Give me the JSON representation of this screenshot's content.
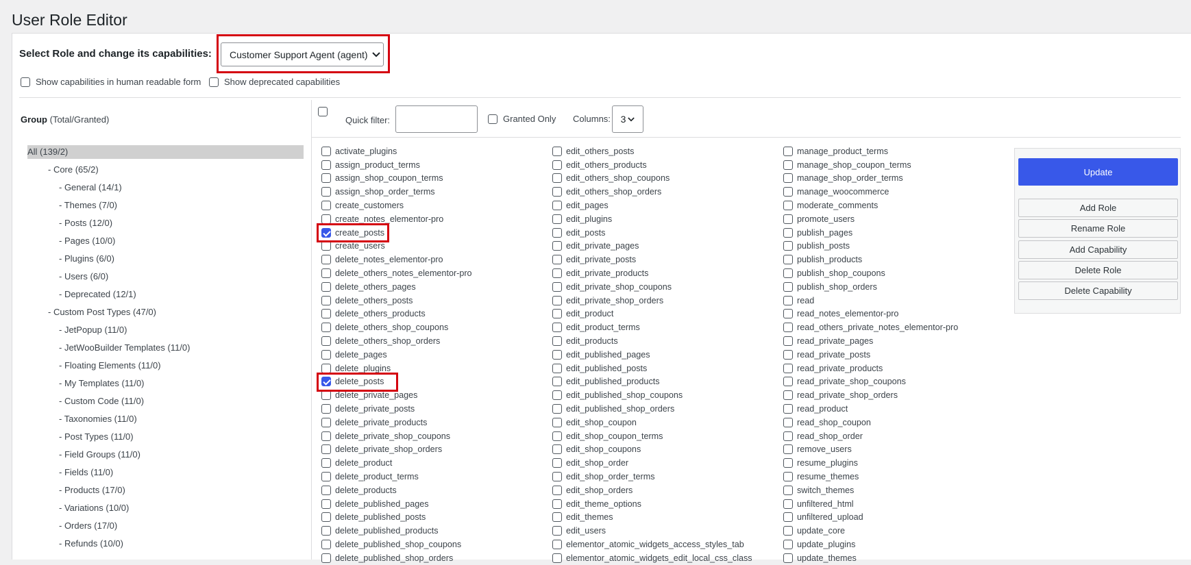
{
  "page_title": "User Role Editor",
  "role_select": {
    "label": "Select Role and change its capabilities:",
    "value": "Customer Support Agent (agent)"
  },
  "options": {
    "human_readable": "Show capabilities in human readable form",
    "deprecated": "Show deprecated capabilities"
  },
  "group_header": {
    "title": "Group",
    "subtitle": "(Total/Granted)"
  },
  "groups": [
    "All (139/2)",
    "- Core (65/2)",
    "- General (14/1)",
    "- Themes (7/0)",
    "- Posts (12/0)",
    "- Pages (10/0)",
    "- Plugins (6/0)",
    "- Users (6/0)",
    "- Deprecated (12/1)",
    "- Custom Post Types (47/0)",
    "- JetPopup (11/0)",
    "- JetWooBuilder Templates (11/0)",
    "- Floating Elements (11/0)",
    "- My Templates (11/0)",
    "- Custom Code (11/0)",
    "- Taxonomies (11/0)",
    "- Post Types (11/0)",
    "- Field Groups (11/0)",
    "- Fields (11/0)",
    "- Products (17/0)",
    "- Variations (10/0)",
    "- Orders (17/0)",
    "- Refunds (10/0)"
  ],
  "filter": {
    "quick_filter_label": "Quick filter:",
    "quick_filter_value": "",
    "granted_only_label": "Granted Only",
    "columns_label": "Columns:",
    "columns_value": "3"
  },
  "capabilities": {
    "col1": [
      "activate_plugins",
      "assign_product_terms",
      "assign_shop_coupon_terms",
      "assign_shop_order_terms",
      "create_customers",
      "create_notes_elementor-pro",
      "create_posts",
      "create_users",
      "delete_notes_elementor-pro",
      "delete_others_notes_elementor-pro",
      "delete_others_pages",
      "delete_others_posts",
      "delete_others_products",
      "delete_others_shop_coupons",
      "delete_others_shop_orders",
      "delete_pages",
      "delete_plugins",
      "delete_posts",
      "delete_private_pages",
      "delete_private_posts",
      "delete_private_products",
      "delete_private_shop_coupons",
      "delete_private_shop_orders",
      "delete_product",
      "delete_product_terms",
      "delete_products",
      "delete_published_pages",
      "delete_published_posts",
      "delete_published_products",
      "delete_published_shop_coupons",
      "delete_published_shop_orders"
    ],
    "col2": [
      "edit_others_posts",
      "edit_others_products",
      "edit_others_shop_coupons",
      "edit_others_shop_orders",
      "edit_pages",
      "edit_plugins",
      "edit_posts",
      "edit_private_pages",
      "edit_private_posts",
      "edit_private_products",
      "edit_private_shop_coupons",
      "edit_private_shop_orders",
      "edit_product",
      "edit_product_terms",
      "edit_products",
      "edit_published_pages",
      "edit_published_posts",
      "edit_published_products",
      "edit_published_shop_coupons",
      "edit_published_shop_orders",
      "edit_shop_coupon",
      "edit_shop_coupon_terms",
      "edit_shop_coupons",
      "edit_shop_order",
      "edit_shop_order_terms",
      "edit_shop_orders",
      "edit_theme_options",
      "edit_themes",
      "edit_users",
      "elementor_atomic_widgets_access_styles_tab",
      "elementor_atomic_widgets_edit_local_css_class"
    ],
    "col3": [
      "manage_product_terms",
      "manage_shop_coupon_terms",
      "manage_shop_order_terms",
      "manage_woocommerce",
      "moderate_comments",
      "promote_users",
      "publish_pages",
      "publish_posts",
      "publish_products",
      "publish_shop_coupons",
      "publish_shop_orders",
      "read",
      "read_notes_elementor-pro",
      "read_others_private_notes_elementor-pro",
      "read_private_pages",
      "read_private_posts",
      "read_private_products",
      "read_private_shop_coupons",
      "read_private_shop_orders",
      "read_product",
      "read_shop_coupon",
      "read_shop_order",
      "remove_users",
      "resume_plugins",
      "resume_themes",
      "switch_themes",
      "unfiltered_html",
      "unfiltered_upload",
      "update_core",
      "update_plugins",
      "update_themes"
    ],
    "granted": [
      "create_posts",
      "delete_posts"
    ]
  },
  "actions": {
    "update": "Update",
    "add_role": "Add Role",
    "rename_role": "Rename Role",
    "add_capability": "Add Capability",
    "delete_role": "Delete Role",
    "delete_capability": "Delete Capability"
  },
  "colors": {
    "accent": "#3858e9",
    "highlight": "#d4000f"
  }
}
